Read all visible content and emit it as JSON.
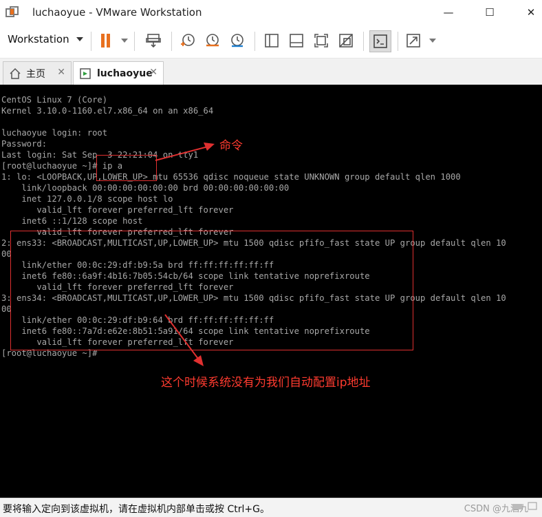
{
  "window": {
    "title": "luchaoyue - VMware Workstation",
    "minimize_glyph": "—",
    "maximize_glyph": "☐",
    "close_glyph": "✕"
  },
  "toolbar": {
    "menu_label": "Workstation",
    "menu_icon": "chevron-down-icon",
    "accent_color": "#e8701e",
    "buttons": [
      "pause-icon",
      "send-ctrl-alt-del-icon",
      "snapshot-icon",
      "revert-snapshot-icon",
      "manage-snapshots-icon",
      "sidebar-icon",
      "thumbnail-bar-icon",
      "fullscreen-icon",
      "unity-icon",
      "console-view-icon",
      "stretch-icon"
    ]
  },
  "tabs": [
    {
      "label": "主页",
      "icon": "home-icon",
      "active": false
    },
    {
      "label": "luchaoyue",
      "icon": "vm-icon",
      "active": true
    }
  ],
  "console": {
    "lines": [
      "CentOS Linux 7 (Core)",
      "Kernel 3.10.0-1160.el7.x86_64 on an x86_64",
      "",
      "luchaoyue login: root",
      "Password:",
      "Last login: Sat Sep  3 22:21:04 on tty1",
      "[root@luchaoyue ~]# ip a",
      "1: lo: <LOOPBACK,UP,LOWER_UP> mtu 65536 qdisc noqueue state UNKNOWN group default qlen 1000",
      "    link/loopback 00:00:00:00:00:00 brd 00:00:00:00:00:00",
      "    inet 127.0.0.1/8 scope host lo",
      "       valid_lft forever preferred_lft forever",
      "    inet6 ::1/128 scope host",
      "       valid_lft forever preferred_lft forever",
      "2: ens33: <BROADCAST,MULTICAST,UP,LOWER_UP> mtu 1500 qdisc pfifo_fast state UP group default qlen 10",
      "00",
      "    link/ether 00:0c:29:df:b9:5a brd ff:ff:ff:ff:ff:ff",
      "    inet6 fe80::6a9f:4b16:7b05:54cb/64 scope link tentative noprefixroute",
      "       valid_lft forever preferred_lft forever",
      "3: ens34: <BROADCAST,MULTICAST,UP,LOWER_UP> mtu 1500 qdisc pfifo_fast state UP group default qlen 10",
      "00",
      "    link/ether 00:0c:29:df:b9:64 brd ff:ff:ff:ff:ff:ff",
      "    inet6 fe80::7a7d:e62e:8b51:5a91/64 scope link tentative noprefixroute",
      "       valid_lft forever preferred_lft forever",
      "[root@luchaoyue ~]#"
    ]
  },
  "annotations": {
    "command_label": "命令",
    "explanation": "这个时候系统没有为我们自动配置ip地址",
    "color": "#ff3b2f"
  },
  "statusbar": {
    "text": "要将输入定向到该虚拟机，请在虚拟机内部单击或按 Ctrl+G。",
    "watermark": "CSDN @九酒九"
  }
}
